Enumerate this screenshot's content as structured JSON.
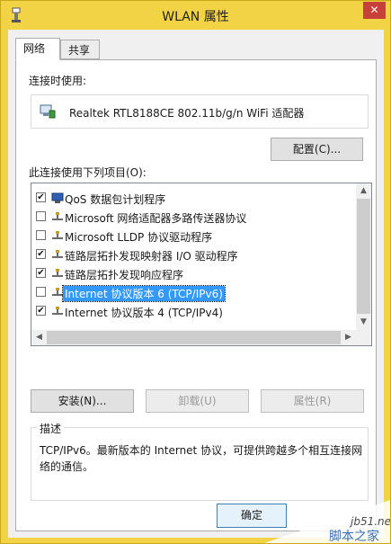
{
  "window": {
    "title": "WLAN 属性",
    "close_label": "✕"
  },
  "tabs": [
    {
      "label": "网络"
    },
    {
      "label": "共享"
    }
  ],
  "connect_using": {
    "label": "连接时使用:",
    "adapter_name": "Realtek RTL8188CE 802.11b/g/n WiFi 适配器",
    "configure_label": "配置(C)..."
  },
  "items_label": "此连接使用下列项目(O):",
  "items": [
    {
      "label": "QoS 数据包计划程序",
      "checked": true,
      "icon": "qos-icon"
    },
    {
      "label": "Microsoft 网络适配器多路传送器协议",
      "checked": false,
      "icon": "protocol-icon"
    },
    {
      "label": "Microsoft LLDP 协议驱动程序",
      "checked": false,
      "icon": "protocol-icon"
    },
    {
      "label": "链路层拓扑发现映射器 I/O 驱动程序",
      "checked": true,
      "icon": "protocol-icon"
    },
    {
      "label": "链路层拓扑发现响应程序",
      "checked": true,
      "icon": "protocol-icon"
    },
    {
      "label": "Internet 协议版本 6 (TCP/IPv6)",
      "checked": false,
      "icon": "protocol-icon",
      "selected": true
    },
    {
      "label": "Internet 协议版本 4 (TCP/IPv4)",
      "checked": true,
      "icon": "protocol-icon"
    }
  ],
  "buttons": {
    "install": "安装(N)...",
    "uninstall": "卸载(U)",
    "properties": "属性(R)"
  },
  "description": {
    "title": "描述",
    "text": "TCP/IPv6。最新版本的 Internet 协议，可提供跨越多个相互连接网络的通信。"
  },
  "ok_label": "确定",
  "watermark": {
    "site": "jb51.net",
    "name": "脚本之家"
  },
  "colors": {
    "accent": "#f2d346",
    "selection": "#3399ff",
    "close": "#c7403a"
  }
}
